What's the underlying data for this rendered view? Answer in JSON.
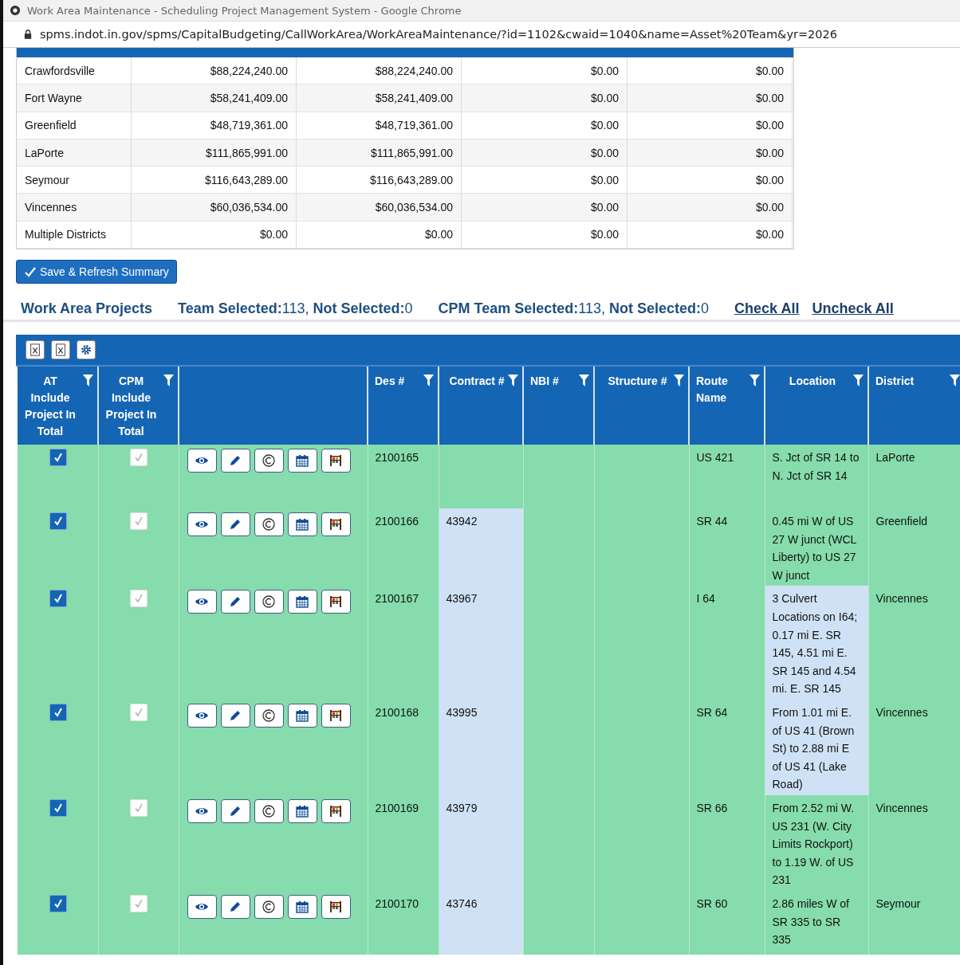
{
  "browser": {
    "title": "Work Area Maintenance - Scheduling Project Management System - Google Chrome",
    "url": "spms.indot.in.gov/spms/CapitalBudgeting/CallWorkArea/WorkAreaMaintenance/?id=1102&cwaid=1040&name=Asset%20Team&yr=2026"
  },
  "summary_table": {
    "rows": [
      {
        "district": "Crawfordsville",
        "column_2": "$88,224,240.00",
        "column_3": "$88,224,240.00",
        "column_4": "$0.00",
        "column_5": "$0.00"
      },
      {
        "district": "Fort Wayne",
        "column_2": "$58,241,409.00",
        "column_3": "$58,241,409.00",
        "column_4": "$0.00",
        "column_5": "$0.00"
      },
      {
        "district": "Greenfield",
        "column_2": "$48,719,361.00",
        "column_3": "$48,719,361.00",
        "column_4": "$0.00",
        "column_5": "$0.00"
      },
      {
        "district": "LaPorte",
        "column_2": "$111,865,991.00",
        "column_3": "$111,865,991.00",
        "column_4": "$0.00",
        "column_5": "$0.00"
      },
      {
        "district": "Seymour",
        "column_2": "$116,643,289.00",
        "column_3": "$116,643,289.00",
        "column_4": "$0.00",
        "column_5": "$0.00"
      },
      {
        "district": "Vincennes",
        "column_2": "$60,036,534.00",
        "column_3": "$60,036,534.00",
        "column_4": "$0.00",
        "column_5": "$0.00"
      },
      {
        "district": "Multiple Districts",
        "column_2": "$0.00",
        "column_3": "$0.00",
        "column_4": "$0.00",
        "column_5": "$0.00"
      }
    ]
  },
  "save_button": "Save & Refresh Summary",
  "section": {
    "title": "Work Area Projects",
    "team_status": "**Team Selected:**113, **Not Selected:**0",
    "cpm_status": "**CPM Team Selected:**113, **Not Selected:**0",
    "links": [
      "Check All",
      "Uncheck All"
    ]
  },
  "grid": {
    "columns": [
      {
        "label": "AT Include Project In Total",
        "filter": true
      },
      {
        "label": "CPM Include Project In Total",
        "filter": true
      },
      {
        "filter": false
      },
      {
        "label": "Des #",
        "filter": true
      },
      {
        "label": "Contract #",
        "filter": true
      },
      {
        "label": "NBI #",
        "filter": true
      },
      {
        "label": "Structure #",
        "filter": true
      },
      {
        "label": "Route Name",
        "filter": true
      },
      {
        "label": "Location",
        "filter": true
      },
      {
        "label": "District",
        "filter": true
      }
    ],
    "rows": [
      {
        "at_include": true,
        "cpm_include": true,
        "cpm_disabled": true,
        "des": "2100165",
        "contract_highlighted": false,
        "route": "US 421",
        "location": "S. Jct of SR 14 to N. Jct of SR 14",
        "location_highlighted": false,
        "district": "LaPorte"
      },
      {
        "at_include": true,
        "cpm_include": true,
        "cpm_disabled": true,
        "des": "2100166",
        "contract": "43942",
        "contract_highlighted": true,
        "route": "SR 44",
        "location": "0.45 mi W of US 27 W junct (WCL Liberty) to US 27 W junct",
        "location_highlighted": false,
        "district": "Greenfield"
      },
      {
        "at_include": true,
        "cpm_include": true,
        "cpm_disabled": true,
        "des": "2100167",
        "contract": "43967",
        "contract_highlighted": true,
        "route": "I 64",
        "location": "3 Culvert Locations on I64; 0.17 mi E. SR 145, 4.51 mi E. SR 145 and 4.54 mi. E. SR 145",
        "location_highlighted": true,
        "district": "Vincennes"
      },
      {
        "at_include": true,
        "cpm_include": true,
        "cpm_disabled": true,
        "des": "2100168",
        "contract": "43995",
        "contract_highlighted": true,
        "route": "SR 64",
        "location": "From 1.01 mi E. of US 41 (Brown St) to 2.88 mi E of US 41 (Lake Road)",
        "location_highlighted": true,
        "district": "Vincennes"
      },
      {
        "at_include": true,
        "cpm_include": true,
        "cpm_disabled": true,
        "des": "2100169",
        "contract": "43979",
        "contract_highlighted": true,
        "route": "SR 66",
        "location": "From 2.52 mi W. US 231 (W. City Limits Rockport) to 1.19 W. of US 231",
        "location_highlighted": false,
        "district": "Vincennes"
      },
      {
        "at_include": true,
        "cpm_include": true,
        "cpm_disabled": true,
        "des": "2100170",
        "contract": "43746",
        "contract_highlighted": true,
        "route": "SR 60",
        "location": "2.86 miles W of SR 335 to SR 335",
        "location_highlighted": false,
        "district": "Seymour"
      }
    ]
  }
}
